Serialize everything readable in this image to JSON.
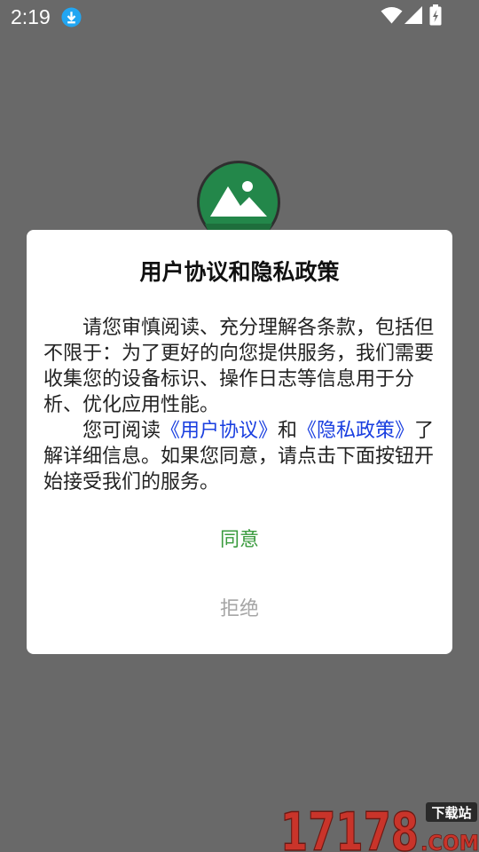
{
  "status_bar": {
    "time": "2:19",
    "icons": [
      "download-icon",
      "wifi-icon",
      "signal-icon",
      "battery-icon"
    ]
  },
  "background": {
    "logo_icon": "app-logo-icon"
  },
  "dialog": {
    "title": "用户协议和隐私政策",
    "paragraph1": "请您审慎阅读、充分理解各条款，包括但不限于：为了更好的向您提供服务，我们需要收集您的设备标识、操作日志等信息用于分析、优化应用性能。",
    "paragraph2_prefix": "您可阅读",
    "user_agreement_link": "《用户协议》",
    "paragraph2_and": "和",
    "privacy_policy_link": "《隐私政策》",
    "paragraph2_suffix": "了解详细信息。如果您同意，请点击下面按钮开始接受我们的服务。",
    "agree_label": "同意",
    "refuse_label": "拒绝"
  },
  "watermark": {
    "text": "17178",
    "tag": "下载站",
    "domain": ".COM"
  },
  "colors": {
    "overlay": "#696969",
    "agree": "#3a9b3e",
    "refuse": "#a6a6a6",
    "link": "#1a3fe0",
    "logo_green": "#23874a"
  }
}
